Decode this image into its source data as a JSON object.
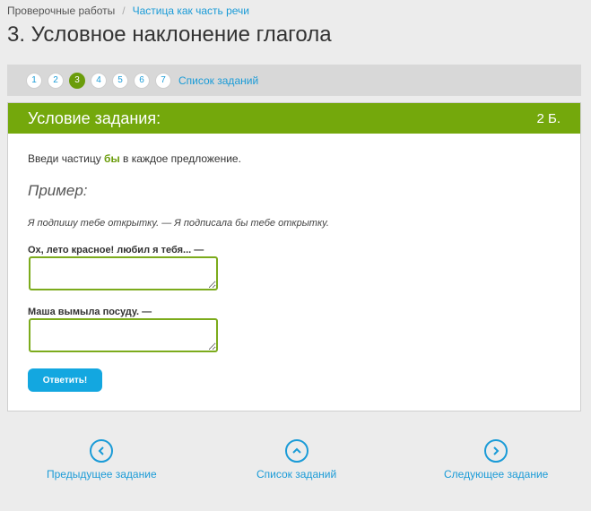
{
  "breadcrumb": {
    "root": "Проверочные работы",
    "separator": "/",
    "current": "Частица как часть речи"
  },
  "page_title": "3. Условное наклонение глагола",
  "task_nav": {
    "numbers": [
      "1",
      "2",
      "3",
      "4",
      "5",
      "6",
      "7"
    ],
    "active": "3",
    "list_link": "Список заданий"
  },
  "card": {
    "header_title": "Условие задания:",
    "points": "2 Б.",
    "instruction_before": "Введи частицу ",
    "instruction_highlight": "бы",
    "instruction_after": " в каждое предложение.",
    "example_title": "Пример:",
    "example_text": "Я подпишу тебе открытку. — Я подписала бы тебе открытку.",
    "questions": [
      {
        "label": "Ох, лето красное! любил я тебя... —",
        "value": ""
      },
      {
        "label": "Маша вымыла посуду. —",
        "value": ""
      }
    ],
    "submit_label": "Ответить!"
  },
  "bottom_nav": {
    "prev": "Предыдущее задание",
    "list": "Список заданий",
    "next": "Следующее задание"
  },
  "colors": {
    "accent_green": "#74a80c",
    "link_blue": "#1a9bd7",
    "button_blue": "#13a7e0"
  }
}
